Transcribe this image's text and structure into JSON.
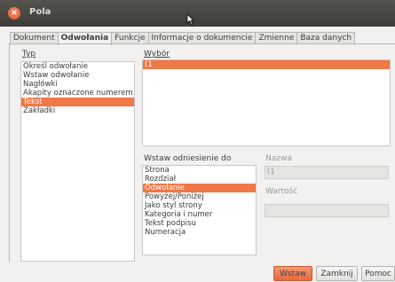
{
  "window": {
    "title": "Pola",
    "close_glyph": "×"
  },
  "tabs": [
    "Dokument",
    "Odwołania",
    "Funkcje",
    "Informacje o dokumencie",
    "Zmienne",
    "Baza danych"
  ],
  "active_tab": "Odwołania",
  "type_section": {
    "label": "Typ",
    "items": [
      "Określ odwołanie",
      "Wstaw odwołanie",
      "Nagłówki",
      "Akapity oznaczone numerem",
      "Tekst",
      "Zakładki"
    ],
    "selected": "Tekst"
  },
  "selection_section": {
    "label": "Wybór",
    "items": [
      "(1"
    ],
    "selected": "(1"
  },
  "insert_ref": {
    "label": "Wstaw odniesienie do",
    "items": [
      "Strona",
      "Rozdział",
      "Odwołanie",
      "Powyżej/Poniżej",
      "Jako styl strony",
      "Kategoria i numer",
      "Tekst podpisu",
      "Numeracja"
    ],
    "selected": "Odwołanie"
  },
  "name_field": {
    "label": "Nazwa",
    "value": "(1"
  },
  "value_field": {
    "label": "Wartość",
    "value": ""
  },
  "buttons": {
    "insert": "Wstaw",
    "close": "Zamknij",
    "help": "Pomoc"
  },
  "colors": {
    "accent": "#f07746",
    "titlebar": "#3d3c38",
    "background": "#f2f1f0"
  }
}
